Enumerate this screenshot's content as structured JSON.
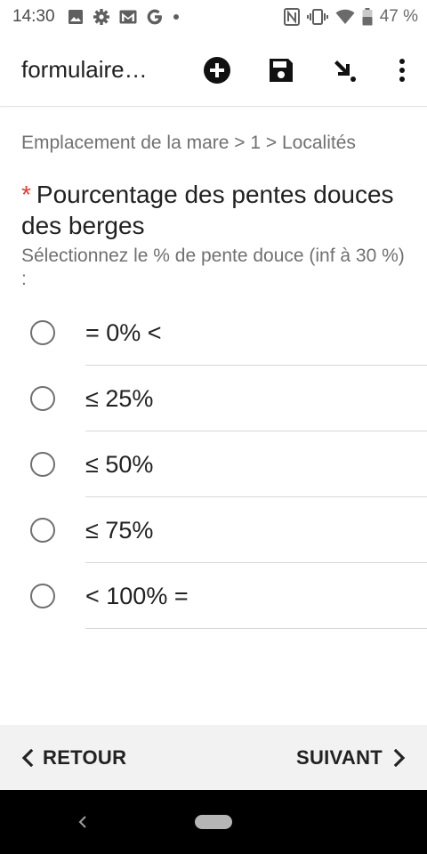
{
  "status_bar": {
    "time": "14:30",
    "battery_percent": "47 %",
    "left_icons": [
      "image-icon",
      "settings-gear-icon",
      "gmail-icon",
      "google-icon",
      "dot-icon"
    ],
    "right_icons": [
      "nfc-icon",
      "vibrate-icon",
      "wifi-icon",
      "battery-icon"
    ]
  },
  "app_bar": {
    "title": "formulaire…",
    "actions": [
      "add-circle-icon",
      "save-icon",
      "go-to-icon",
      "more-vert-icon"
    ]
  },
  "breadcrumb": "Emplacement de la mare > 1 > Localités",
  "question": {
    "required_mark": "*",
    "label": "Pourcentage des pentes douces des berges",
    "hint": "Sélectionnez le % de pente douce (inf à 30 %) :"
  },
  "options": [
    {
      "label": "= 0% <",
      "selected": false
    },
    {
      "label": "≤ 25%",
      "selected": false
    },
    {
      "label": "≤ 50%",
      "selected": false
    },
    {
      "label": "≤ 75%",
      "selected": false
    },
    {
      "label": "< 100% =",
      "selected": false
    }
  ],
  "navigation": {
    "back_label": "RETOUR",
    "next_label": "SUIVANT"
  },
  "colors": {
    "required": "#e53935",
    "bottom_bar": "#f2f2f2",
    "system_nav": "#000000"
  }
}
